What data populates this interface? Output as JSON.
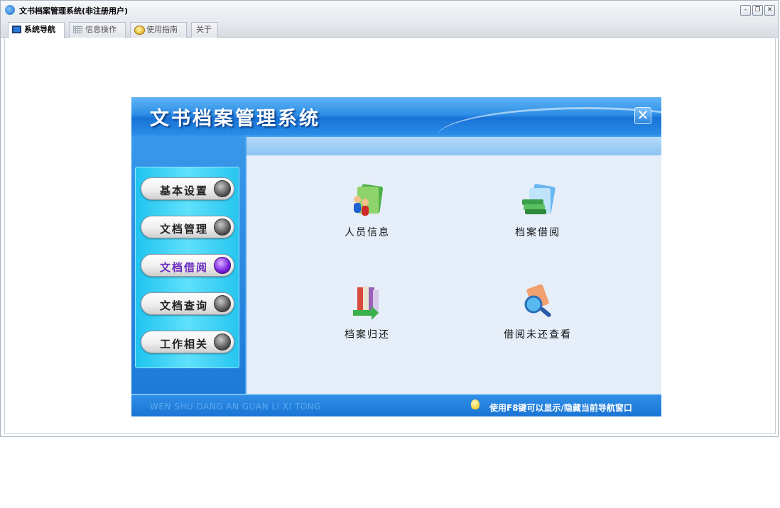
{
  "window": {
    "title": "文书档案管理系统(非注册用户)",
    "controls": [
      "minimize",
      "restore",
      "close"
    ]
  },
  "tabs": [
    {
      "label": "系统导航",
      "icon": "monitor-icon",
      "active": true
    },
    {
      "label": "信息操作",
      "icon": "grid-icon",
      "active": false
    },
    {
      "label": "使用指南",
      "icon": "help-icon",
      "active": false
    },
    {
      "label": "关于",
      "icon": "",
      "active": false
    }
  ],
  "panel": {
    "title": "文书档案管理系统",
    "nav": [
      {
        "label": "基本设置",
        "active": false
      },
      {
        "label": "文档管理",
        "active": false
      },
      {
        "label": "文档借阅",
        "active": true
      },
      {
        "label": "文档查询",
        "active": false
      },
      {
        "label": "工作相关",
        "active": false
      }
    ],
    "functions": [
      {
        "label": "人员信息",
        "icon": "people-folder-icon"
      },
      {
        "label": "档案借阅",
        "icon": "books-folder-icon"
      },
      {
        "label": "档案归还",
        "icon": "books-return-icon"
      },
      {
        "label": "借阅未还查看",
        "icon": "magnifier-icon"
      }
    ],
    "footer": {
      "pinyin": "WEN SHU DANG AN GUAN LI XI TONG",
      "tip": "使用F8键可以显示/隐藏当前导航窗口"
    }
  },
  "colors": {
    "accent": "#1e7ad8",
    "active_led": "#7a1fe0",
    "content_bg": "#e6eef9"
  }
}
